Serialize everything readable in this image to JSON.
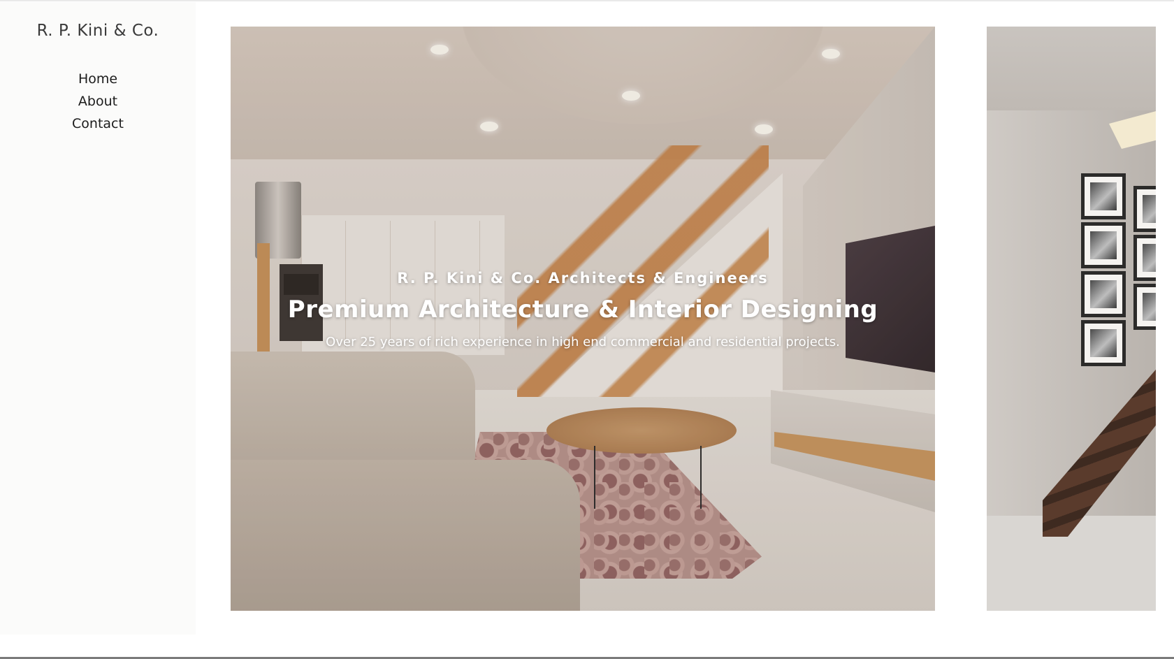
{
  "brand": {
    "name": "R. P. Kini & Co."
  },
  "nav": {
    "items": [
      {
        "label": "Home"
      },
      {
        "label": "About"
      },
      {
        "label": "Contact"
      }
    ]
  },
  "hero": {
    "kicker": "R. P. Kini & Co. Architects & Engineers",
    "title": "Premium Architecture & Interior Designing",
    "subtitle": "Over 25 years of rich experience in high end commercial and residential projects."
  },
  "slides": [
    {
      "name": "living-room-interior"
    },
    {
      "name": "staircase-gallery-interior"
    }
  ],
  "colors": {
    "sidebar_bg": "#fbfbfa",
    "text_dark": "#1c1c1c",
    "hero_text": "#ffffff"
  }
}
